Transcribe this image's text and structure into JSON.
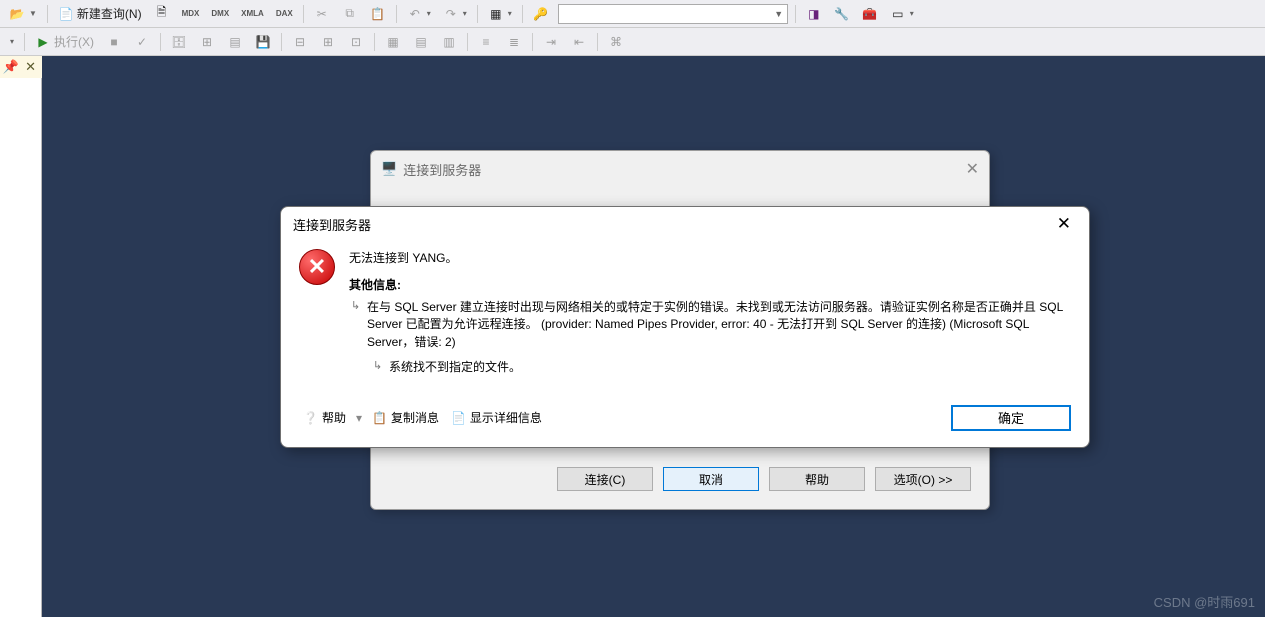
{
  "toolbar": {
    "new_query": "新建查询(N)",
    "execute": "执行(X)",
    "icon_mdx": "MDX",
    "icon_dmx": "DMX",
    "icon_xmla": "XMLA",
    "icon_dax": "DAX"
  },
  "bg_dialog": {
    "title": "连接到服务器",
    "connect": "连接(C)",
    "cancel": "取消",
    "help": "帮助",
    "options": "选项(O) >>"
  },
  "err_dialog": {
    "title": "连接到服务器",
    "cannot_connect": "无法连接到 YANG。",
    "other_info": "其他信息:",
    "para1": "在与 SQL Server 建立连接时出现与网络相关的或特定于实例的错误。未找到或无法访问服务器。请验证实例名称是否正确并且 SQL Server 已配置为允许远程连接。 (provider: Named Pipes Provider, error: 40 - 无法打开到 SQL Server 的连接) (Microsoft SQL Server，错误: 2)",
    "para2": "系统找不到指定的文件。",
    "help": "帮助",
    "copy": "复制消息",
    "details": "显示详细信息",
    "ok": "确定"
  },
  "watermark": "CSDN @时雨691"
}
